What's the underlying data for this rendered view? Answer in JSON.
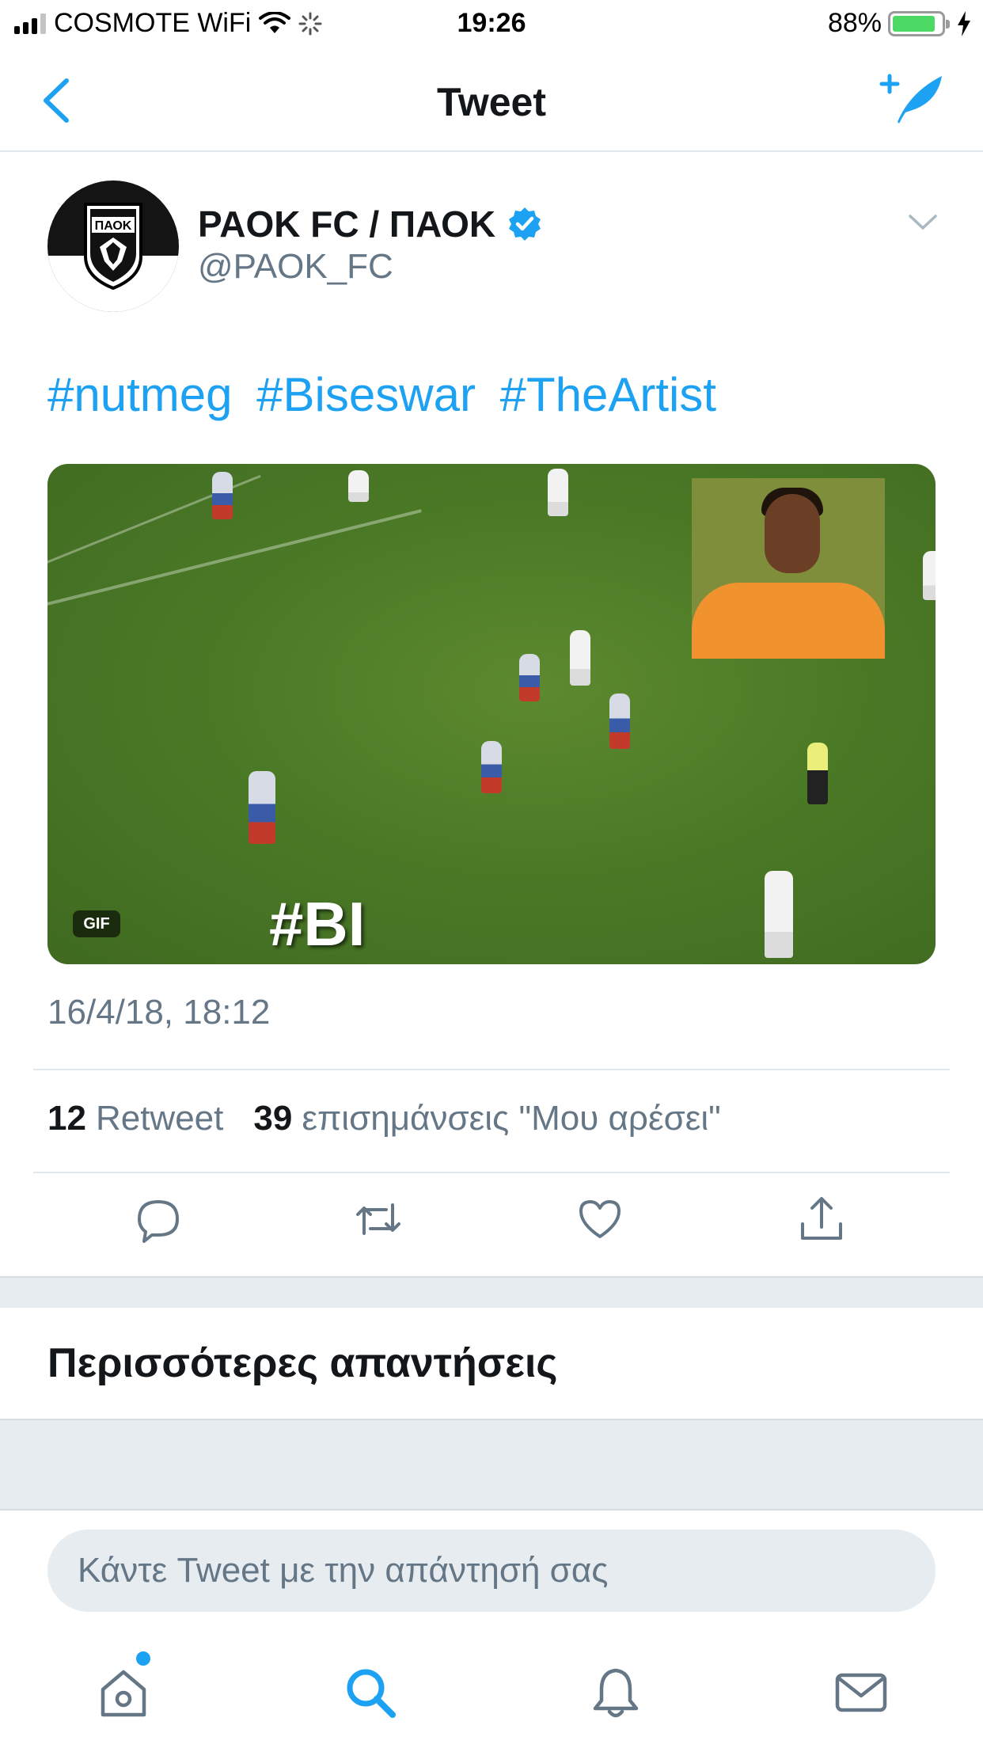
{
  "status_bar": {
    "carrier": "COSMOTE WiFi",
    "time": "19:26",
    "battery_percent": "88%",
    "battery_level": 0.88,
    "icons": [
      "signal-icon",
      "wifi-icon",
      "loading-spinner-icon",
      "battery-icon",
      "charging-bolt-icon"
    ]
  },
  "nav": {
    "title": "Tweet",
    "back_icon": "chevron-left-icon",
    "compose_icon": "compose-tweet-icon"
  },
  "tweet": {
    "author_name": "PAOK FC / ΠΑΟΚ",
    "author_handle": "@PAOK_FC",
    "avatar_text": "ΠΑΟΚ",
    "hashtags": [
      "#nutmeg",
      "#Biseswar",
      "#TheArtist"
    ],
    "media": {
      "type_badge": "GIF",
      "overlay_text": "#BI"
    },
    "timestamp": "16/4/18, 18:12",
    "retweet_count": "12",
    "retweet_label": "Retweet",
    "like_count": "39",
    "like_label": "επισημάνσεις \"Μου αρέσει\""
  },
  "actions": [
    "reply-icon",
    "retweet-icon",
    "like-icon",
    "share-icon"
  ],
  "more_replies_title": "Περισσότερες απαντήσεις",
  "reply": {
    "placeholder": "Κάντε Tweet με την απάντησή σας"
  },
  "tab_bar": [
    "home-icon",
    "search-icon",
    "notifications-icon",
    "messages-icon"
  ],
  "colors": {
    "accent": "#1da1f2",
    "text": "#14171a",
    "secondary": "#657786",
    "divider": "#e1e8ed",
    "battery": "#4cd964"
  }
}
